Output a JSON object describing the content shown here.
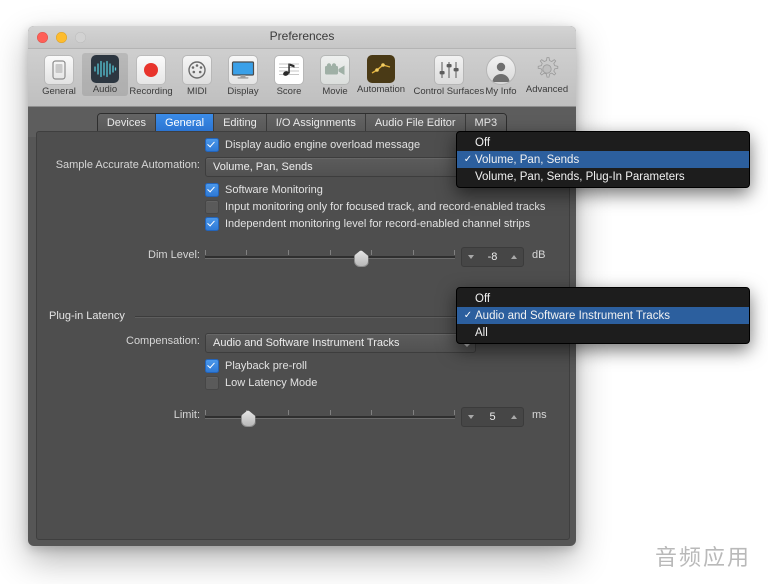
{
  "window": {
    "title": "Preferences",
    "traffic_lights": [
      "close-button",
      "minimize-button",
      "zoom-button"
    ]
  },
  "toolbar": {
    "items": [
      {
        "label": "General",
        "icon": "general-icon",
        "selected": false
      },
      {
        "label": "Audio",
        "icon": "audio-waveform-icon",
        "selected": true
      },
      {
        "label": "Recording",
        "icon": "record-dot-icon",
        "selected": false
      },
      {
        "label": "MIDI",
        "icon": "midi-connector-icon",
        "selected": false
      },
      {
        "label": "Display",
        "icon": "display-monitor-icon",
        "selected": false
      },
      {
        "label": "Score",
        "icon": "score-note-icon",
        "selected": false
      },
      {
        "label": "Movie",
        "icon": "movie-camera-icon",
        "selected": false
      },
      {
        "label": "Automation",
        "icon": "automation-curve-icon",
        "selected": false
      },
      {
        "label": "Control Surfaces",
        "icon": "faders-icon",
        "selected": false
      },
      {
        "label": "My Info",
        "icon": "person-avatar-icon",
        "selected": false
      },
      {
        "label": "Advanced",
        "icon": "gear-icon",
        "selected": false
      }
    ]
  },
  "tabs": [
    {
      "label": "Devices",
      "active": false
    },
    {
      "label": "General",
      "active": true
    },
    {
      "label": "Editing",
      "active": false
    },
    {
      "label": "I/O Assignments",
      "active": false
    },
    {
      "label": "Audio File Editor",
      "active": false
    },
    {
      "label": "MP3",
      "active": false
    }
  ],
  "general_pane": {
    "display_overload": {
      "label": "Display audio engine overload message",
      "checked": true
    },
    "sample_accurate_automation": {
      "label": "Sample Accurate Automation:",
      "value": "Volume, Pan, Sends"
    },
    "software_monitoring": {
      "label": "Software Monitoring",
      "checked": true
    },
    "input_monitoring_only": {
      "label": "Input monitoring only for focused track, and record-enabled tracks",
      "checked": false
    },
    "independent_monitoring": {
      "label": "Independent monitoring level for record-enabled channel strips",
      "checked": true
    },
    "dim_level": {
      "label": "Dim Level:",
      "value": "-8",
      "unit": "dB",
      "percent": 62
    },
    "plugin_latency": {
      "group_label": "Plug-in Latency",
      "compensation": {
        "label": "Compensation:",
        "value": "Audio and Software Instrument Tracks"
      },
      "playback_preroll": {
        "label": "Playback pre-roll",
        "checked": true
      },
      "low_latency_mode": {
        "label": "Low Latency Mode",
        "checked": false
      },
      "limit": {
        "label": "Limit:",
        "value": "5",
        "unit": "ms",
        "percent": 17
      }
    }
  },
  "menus": {
    "sample_accurate_automation": {
      "items": [
        {
          "label": "Off",
          "checked": false,
          "selected": false
        },
        {
          "label": "Volume, Pan, Sends",
          "checked": true,
          "selected": true
        },
        {
          "label": "Volume, Pan, Sends, Plug-In Parameters",
          "checked": false,
          "selected": false
        }
      ]
    },
    "compensation": {
      "items": [
        {
          "label": "Off",
          "checked": false,
          "selected": false
        },
        {
          "label": "Audio and Software Instrument Tracks",
          "checked": true,
          "selected": true
        },
        {
          "label": "All",
          "checked": false,
          "selected": false
        }
      ]
    },
    "check_glyph": "✓"
  },
  "watermark": {
    "text": "音频应用"
  },
  "colors": {
    "accent_blue": "#2a72cf",
    "menu_highlight": "#2c5f9e",
    "pane_bg": "#4e4e4e",
    "window_bg": "#565656"
  }
}
